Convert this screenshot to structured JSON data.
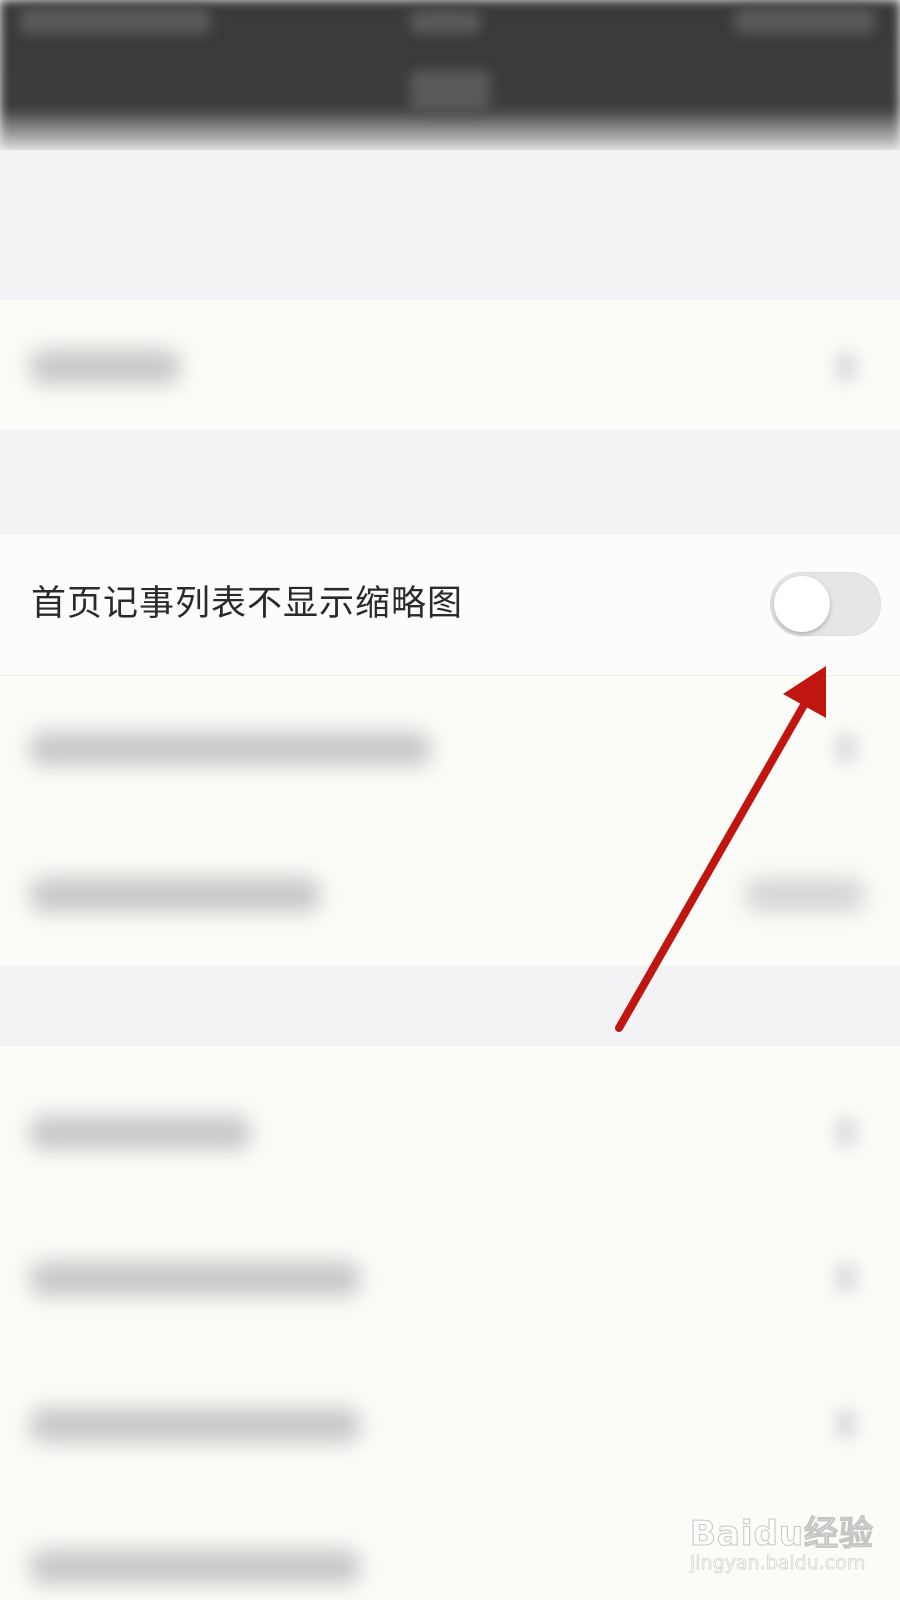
{
  "setting": {
    "label": "首页记事列表不显示缩略图",
    "toggle_on": false
  },
  "annotation": {
    "arrow_color": "#c0160f"
  },
  "watermark": {
    "brand": "Baidu经验",
    "url": "jingyan.baidu.com"
  },
  "colors": {
    "toggle_track": "#e6e6e6",
    "toggle_knob": "#ffffff",
    "page_bg": "#f4f4f6",
    "row_bg": "#fcfcfa"
  }
}
